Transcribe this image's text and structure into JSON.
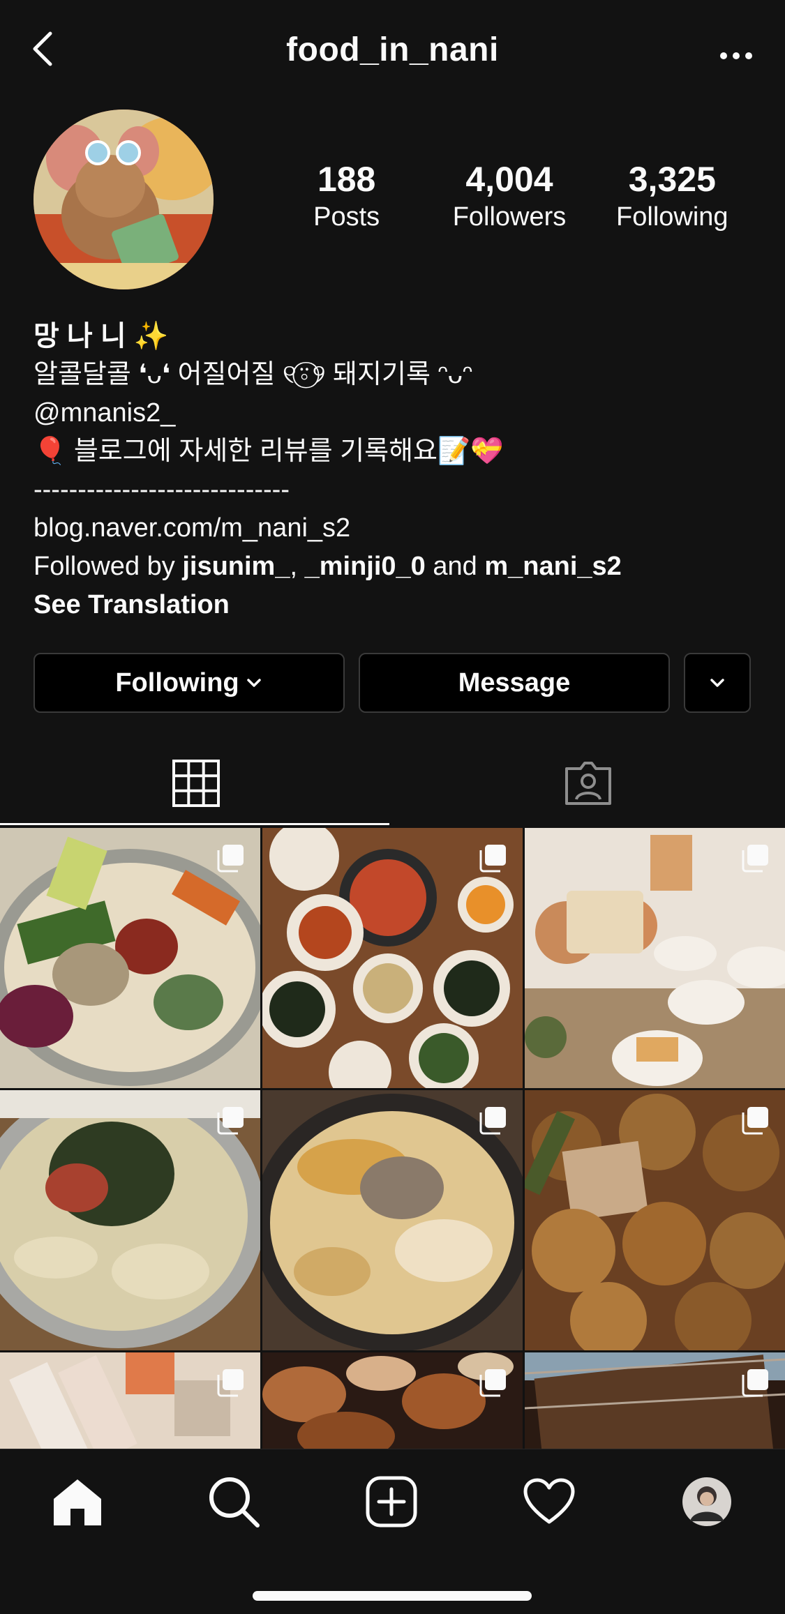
{
  "header": {
    "username": "food_in_nani"
  },
  "profile": {
    "stats": [
      {
        "value": "188",
        "label": "Posts"
      },
      {
        "value": "4,004",
        "label": "Followers"
      },
      {
        "value": "3,325",
        "label": "Following"
      }
    ],
    "display_name": "망 나 니 ✨",
    "bio_line1": "알콜달콜 ❛ᴗ❛ 어질어질 ୧⍤⃝୨ 돼지기록 ᵔᴗᵔ",
    "mention": "@mnanis2_",
    "bio_line3": "🎈 블로그에 자세한 리뷰를 기록해요📝💝",
    "divider": "-----------------------------",
    "link": "blog.naver.com/m_nani_s2",
    "followed_by_prefix": "Followed by ",
    "followed_by_users": [
      "jisunim_",
      "_minji0_0",
      "m_nani_s2"
    ],
    "followed_by_sep1": ", ",
    "followed_by_sep2": " and ",
    "see_translation": "See Translation"
  },
  "actions": {
    "following_label": "Following",
    "message_label": "Message"
  },
  "tabs": [
    {
      "icon": "grid-icon",
      "active": true
    },
    {
      "icon": "tagged-icon",
      "active": false
    }
  ],
  "posts": [
    {
      "name": "bibimbap",
      "colors": [
        "#5e7a3a",
        "#c9c0a4",
        "#8a2a1f",
        "#e8e2d0"
      ]
    },
    {
      "name": "korean-banchan-table",
      "colors": [
        "#7a4a2a",
        "#c2582e",
        "#e9e2d5",
        "#2f3a23"
      ]
    },
    {
      "name": "cafe-cheesecake",
      "colors": [
        "#e7d8c8",
        "#c99b6a",
        "#f2ece4",
        "#8a5a3a"
      ]
    },
    {
      "name": "noodle-soup",
      "colors": [
        "#d9cfae",
        "#2e3b22",
        "#a8412f",
        "#c6c0b2"
      ]
    },
    {
      "name": "soondubu-stew",
      "colors": [
        "#d6b06a",
        "#3a3530",
        "#e8d7b6",
        "#7a6a5a"
      ]
    },
    {
      "name": "fried-jeon",
      "colors": [
        "#7a4a24",
        "#b07a3c",
        "#4a5a2a",
        "#c9a070"
      ]
    },
    {
      "name": "sashimi",
      "colors": [
        "#e4d6c6",
        "#e07a4a",
        "#c9b9a6",
        "#7a5a4a"
      ]
    },
    {
      "name": "bbq-grill",
      "colors": [
        "#4a2a1a",
        "#b06a3a",
        "#2a1a14",
        "#d8b08a"
      ]
    },
    {
      "name": "grilled-ribs",
      "colors": [
        "#4a2e1e",
        "#7a5030",
        "#b4a494",
        "#2a1a12"
      ]
    }
  ]
}
